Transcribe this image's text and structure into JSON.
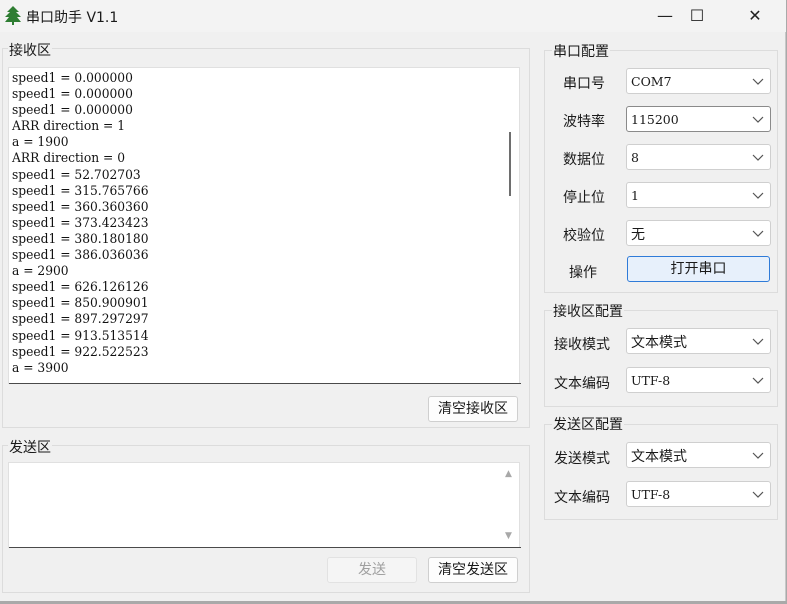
{
  "title_bar": {
    "title": "串口助手 V1.1",
    "minimize_glyph": "—",
    "maximize_glyph": "☐",
    "close_glyph": "✕"
  },
  "receive": {
    "label": "接收区",
    "lines": [
      "speed1 = 0.000000",
      "speed1 = 0.000000",
      "speed1 = 0.000000",
      "ARR direction = 1",
      "a = 1900",
      "ARR direction = 0",
      "speed1 = 52.702703",
      "speed1 = 315.765766",
      "speed1 = 360.360360",
      "speed1 = 373.423423",
      "speed1 = 380.180180",
      "speed1 = 386.036036",
      "a = 2900",
      "speed1 = 626.126126",
      "speed1 = 850.900901",
      "speed1 = 897.297297",
      "speed1 = 913.513514",
      "speed1 = 922.522523",
      "a = 3900"
    ],
    "clear_button": "清空接收区"
  },
  "send": {
    "label": "发送区",
    "value": "",
    "send_button": "发送",
    "clear_button": "清空发送区"
  },
  "serial_config": {
    "label": "串口配置",
    "port_label": "串口号",
    "port_value": "COM7",
    "baud_label": "波特率",
    "baud_value": "115200",
    "databits_label": "数据位",
    "databits_value": "8",
    "stopbits_label": "停止位",
    "stopbits_value": "1",
    "parity_label": "校验位",
    "parity_value": "无",
    "action_label": "操作",
    "open_button": "打开串口"
  },
  "receive_config": {
    "label": "接收区配置",
    "mode_label": "接收模式",
    "mode_value": "文本模式",
    "encoding_label": "文本编码",
    "encoding_value": "UTF-8"
  },
  "send_config": {
    "label": "发送区配置",
    "mode_label": "发送模式",
    "mode_value": "文本模式",
    "encoding_label": "文本编码",
    "encoding_value": "UTF-8"
  },
  "colors": {
    "window_bg": "#f0f0f0",
    "primary_border": "#2f7bd8",
    "icon_green": "#2e7d32"
  },
  "icons": {
    "app": "green-tree-icon",
    "dropdown": "chevron-down-icon"
  }
}
